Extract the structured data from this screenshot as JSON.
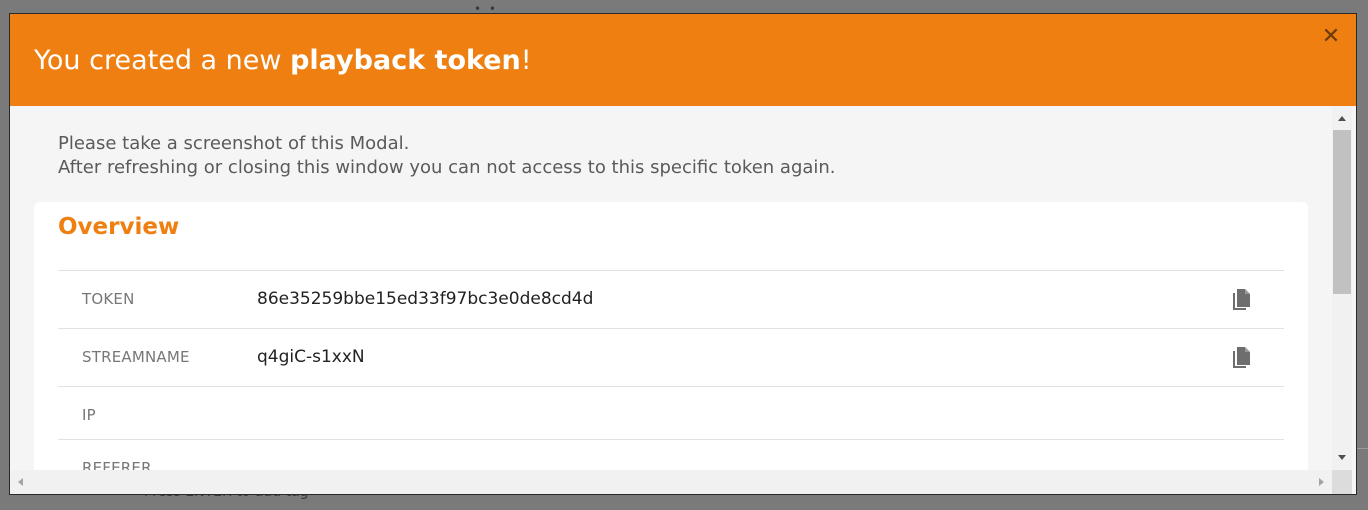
{
  "background": {
    "hint_text": "Press ENTER to add tag",
    "dots": "• •"
  },
  "modal": {
    "title_prefix": "You created a new ",
    "title_emphasis": "playback token",
    "title_suffix": "!",
    "close_glyph": "✕",
    "header_color": "#ee7f10",
    "intro_line1": "Please take a screenshot of this Modal.",
    "intro_line2": "After refreshing or closing this window you can not access to this specific token again."
  },
  "overview": {
    "title": "Overview",
    "rows": [
      {
        "label": "TOKEN",
        "value": "86e35259bbe15ed33f97bc3e0de8cd4d",
        "copy_icon": "copy-icon"
      },
      {
        "label": "STREAMNAME",
        "value": "q4giC-s1xxN",
        "copy_icon": "copy-icon"
      },
      {
        "label": "IP",
        "value": ""
      },
      {
        "label": "REFERER",
        "value": ""
      }
    ]
  },
  "colors": {
    "accent": "#ee7f10",
    "label_gray": "#777777",
    "body_bg": "#f5f5f5"
  }
}
